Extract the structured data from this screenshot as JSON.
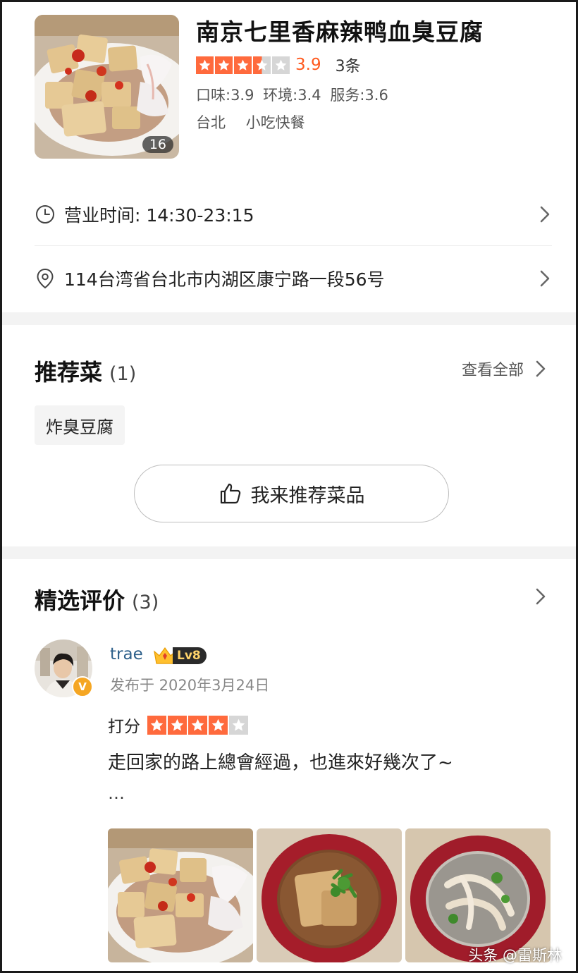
{
  "shop": {
    "name": "南京七里香麻辣鸭血臭豆腐",
    "photo_count": "16",
    "rating": 3.9,
    "rating_text": "3.9",
    "review_count": "3条",
    "sub_scores": {
      "taste": "口味:3.9",
      "environment": "环境:3.4",
      "service": "服务:3.6"
    },
    "city": "台北",
    "category": "小吃快餐"
  },
  "info": {
    "hours": "营业时间:  14:30-23:15",
    "address": "114台湾省台北市内湖区康宁路一段56号"
  },
  "recommend": {
    "title": "推荐菜",
    "count": "(1)",
    "see_all": "查看全部",
    "dishes": [
      "炸臭豆腐"
    ],
    "button_label": "我来推荐菜品"
  },
  "reviews": {
    "title": "精选评价",
    "count": "(3)",
    "items": [
      {
        "user": "trae",
        "level": "Lv8",
        "verified_badge": "V",
        "date": "发布于 2020年3月24日",
        "score_label": "打分",
        "stars": 4,
        "text": "走回家的路上總會經過，也進來好幾次了~",
        "ellipsis": "…"
      }
    ]
  },
  "watermark": "头条 @雷斯林",
  "colors": {
    "accent": "#ff5a1f",
    "star_on": "#ff6a3d",
    "star_off": "#d6d6d6",
    "username": "#2c5f8a"
  },
  "icons": [
    "clock-icon",
    "location-pin-icon",
    "chevron-right-icon",
    "thumbs-up-icon",
    "crown-icon",
    "star-icon"
  ]
}
